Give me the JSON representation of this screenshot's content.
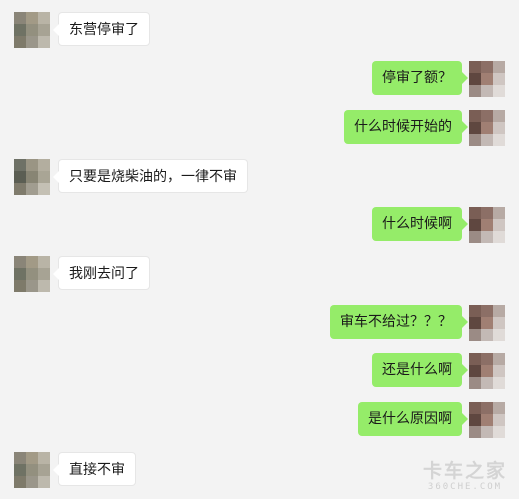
{
  "conversation": {
    "messages": [
      {
        "side": "in",
        "text": "东营停审了"
      },
      {
        "side": "out",
        "text": "停审了额？"
      },
      {
        "side": "out",
        "text": "什么时候开始的"
      },
      {
        "side": "in",
        "text": "只要是烧柴油的，一律不审"
      },
      {
        "side": "out",
        "text": "什么时候啊"
      },
      {
        "side": "in",
        "text": "我刚去问了"
      },
      {
        "side": "out",
        "text": "审车不给过？？？"
      },
      {
        "side": "out",
        "text": "还是什么啊"
      },
      {
        "side": "out",
        "text": "是什么原因啊"
      },
      {
        "side": "in",
        "text": "直接不审"
      }
    ]
  },
  "colors": {
    "background": "#f3f3f3",
    "incoming_bubble": "#ffffff",
    "outgoing_bubble": "#95ec69"
  },
  "watermark": {
    "main": "卡车之家",
    "sub": "360CHE.COM"
  }
}
